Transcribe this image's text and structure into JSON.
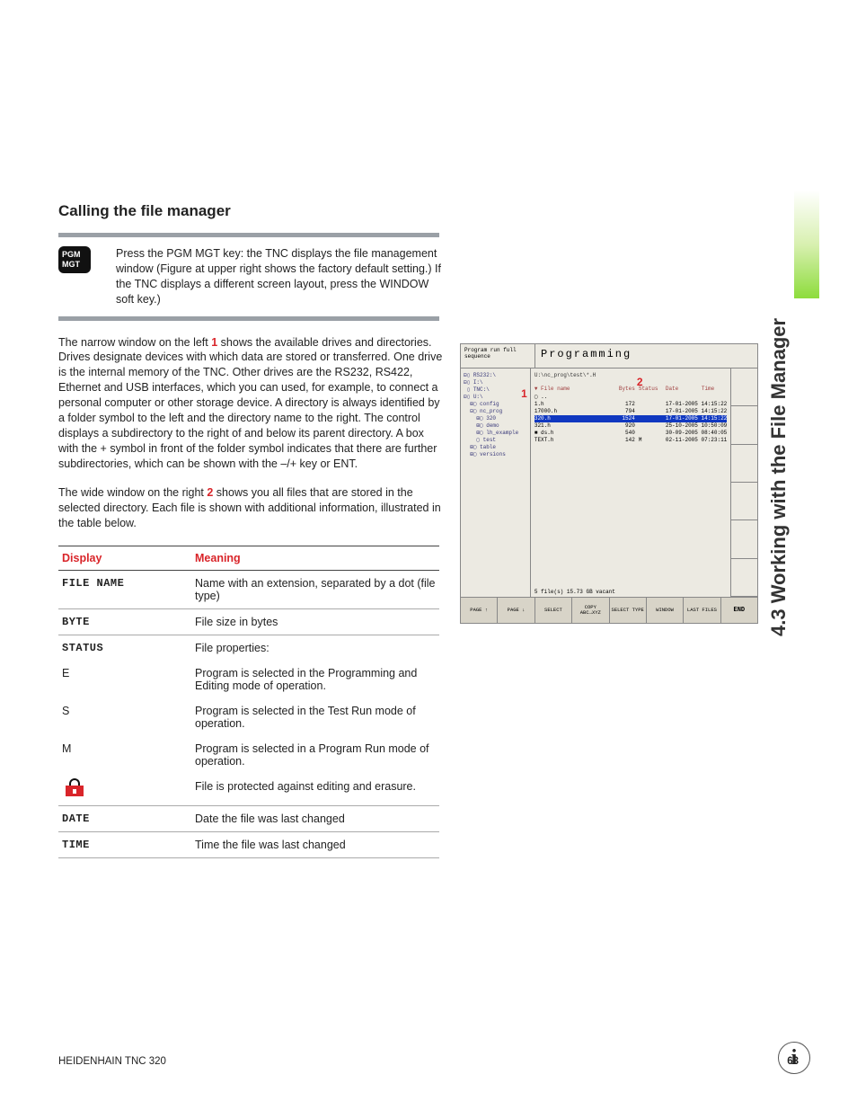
{
  "sidetab": "4.3 Working with the File Manager",
  "heading": "Calling the file manager",
  "pgm_key": {
    "line1": "PGM",
    "line2": "MGT"
  },
  "intro": "Press the PGM MGT key: the TNC displays the file management window (Figure at upper right shows the factory default setting.) If the TNC displays a different screen layout, press the WINDOW soft key.)",
  "para1a": "The narrow window on the left ",
  "callout1": "1",
  "para1b": " shows the available drives and directories. Drives designate devices with which data are stored or transferred. One drive is the internal memory of the TNC. Other drives are the RS232, RS422, Ethernet and USB interfaces, which you can used, for example, to connect a personal computer or other storage device. A directory is always identified by a folder symbol to the left and the directory name to the right. The control displays a subdirectory to the right of and below its parent directory. A box with the + symbol in front of the folder symbol indicates that there are further subdirectories, which can be shown with the –/+ key or ENT.",
  "para2a": "The wide window on the right ",
  "callout2": "2",
  "para2b": " shows you all files that are stored in the selected directory. Each file is shown with additional information, illustrated in the table below.",
  "table": {
    "head1": "Display",
    "head2": "Meaning",
    "rows": [
      {
        "d": "FILE NAME",
        "m": "Name with an extension, separated by a dot (file type)",
        "mono": true,
        "border": true
      },
      {
        "d": "BYTE",
        "m": "File size in bytes",
        "mono": true,
        "border": true
      },
      {
        "d": "STATUS",
        "m": "File properties:",
        "mono": true,
        "border": false
      },
      {
        "d": "E",
        "m": "Program is selected in the Programming and Editing mode of operation.",
        "mono": false,
        "border": false
      },
      {
        "d": "S",
        "m": "Program is selected in the Test Run mode of operation.",
        "mono": false,
        "border": false
      },
      {
        "d": "M",
        "m": "Program is selected in a Program Run mode of operation.",
        "mono": false,
        "border": false
      },
      {
        "d": "__LOCK__",
        "m": "File is protected against editing and erasure.",
        "mono": false,
        "border": true
      },
      {
        "d": "DATE",
        "m": "Date the file was last changed",
        "mono": true,
        "border": true
      },
      {
        "d": "TIME",
        "m": "Time the file was last changed",
        "mono": true,
        "border": true
      }
    ]
  },
  "figure": {
    "mode": "Program run\nfull sequence",
    "title": "Programming",
    "path": "U:\\nc_prog\\test\\*.H",
    "cols": [
      "▼ File name",
      "Bytes",
      "Status",
      "Date",
      "Time"
    ],
    "tree": [
      "⊟▯ RS232:\\",
      "⊟▯ I:\\",
      " ▯ TNC:\\",
      "⊟▯ U:\\",
      "  ⊞▢ config",
      "  ⊟▢ nc_prog",
      "    ⊞▢ 320",
      "    ⊞▢ demo",
      "    ⊞▢ lh_example",
      "    ▢ test",
      "  ⊞▢ table",
      "  ⊞▢ versions"
    ],
    "files": [
      {
        "n": "▢ ..",
        "b": "",
        "s": "",
        "dt": ""
      },
      {
        "n": "1.h",
        "b": "172",
        "s": "",
        "dt": "17-01-2005 14:15:22"
      },
      {
        "n": "17000.h",
        "b": "794",
        "s": "",
        "dt": "17-01-2005 14:15:22"
      },
      {
        "n": "320.h",
        "b": "1524",
        "s": "",
        "dt": "17-01-2005 14:15:22",
        "sel": true
      },
      {
        "n": "321.h",
        "b": "920",
        "s": "",
        "dt": "25-10-2005 10:50:09"
      },
      {
        "n": "■ ds.h",
        "b": "540",
        "s": "",
        "dt": "30-09-2005 08:40:05"
      },
      {
        "n": "TEXT.h",
        "b": "142",
        "s": "M",
        "dt": "02-11-2005 07:23:11"
      }
    ],
    "status": "5   file(s)  15.73 GB vacant",
    "softkeys": [
      "PAGE ↑",
      "PAGE ↓",
      "SELECT",
      "COPY\nABC→XYZ",
      "SELECT\nTYPE",
      "WINDOW",
      "LAST\nFILES",
      "END"
    ]
  },
  "footer": {
    "left": "HEIDENHAIN TNC 320",
    "page": "63"
  }
}
